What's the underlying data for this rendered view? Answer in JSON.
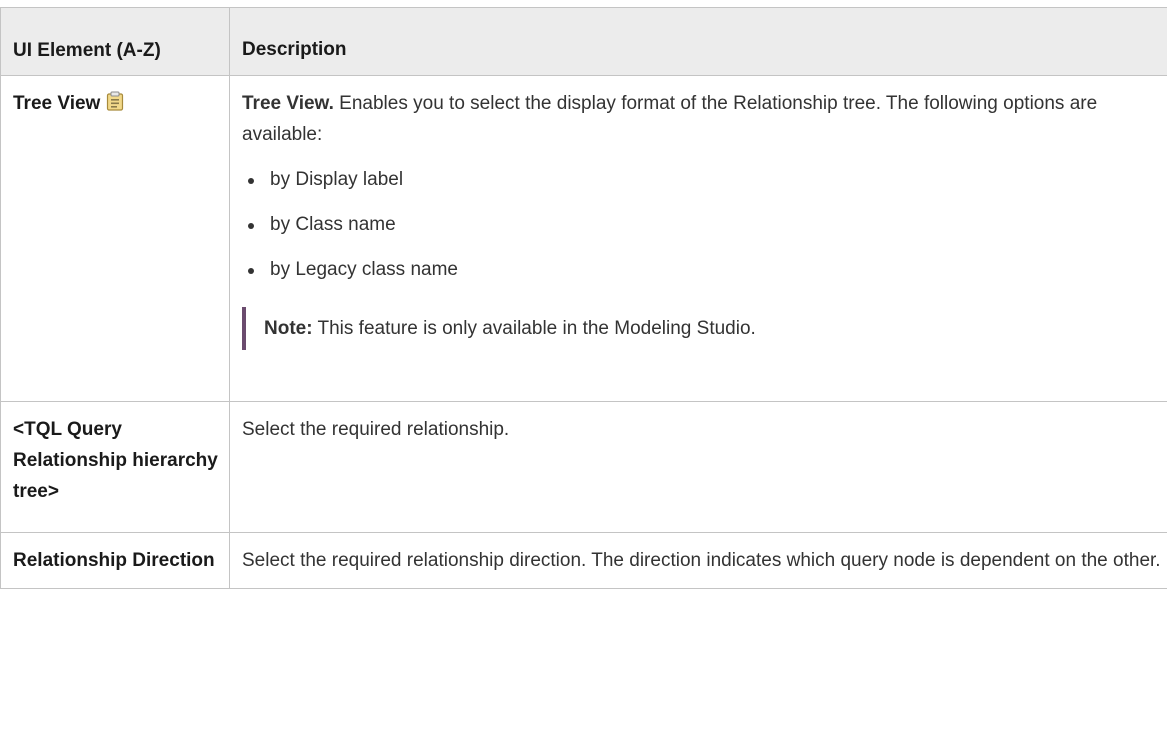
{
  "table": {
    "headers": {
      "element": "UI Element (A-Z)",
      "description": "Description"
    },
    "rows": [
      {
        "element": "Tree View",
        "icon": "tree-view-tag-icon",
        "lead": "Tree View.",
        "text": " Enables you to select the display format of the Relationship tree. The following options are available:",
        "options": [
          "by Display label",
          "by Class name",
          "by Legacy class name"
        ],
        "note_label": "Note:",
        "note_text": " This feature is only available in the Modeling Studio."
      },
      {
        "element": "<TQL Query Relationship hierarchy tree>",
        "text": "Select the required relationship."
      },
      {
        "element": "Relationship Direction",
        "text": "Select the required relationship direction. The direction indicates which query node is dependent on the other."
      }
    ]
  },
  "colors": {
    "header_bg": "#ececec",
    "border": "#c4c4c4",
    "text": "#333333",
    "note_bar": "#6b4b6e",
    "icon_fill": "#f2d98a"
  }
}
